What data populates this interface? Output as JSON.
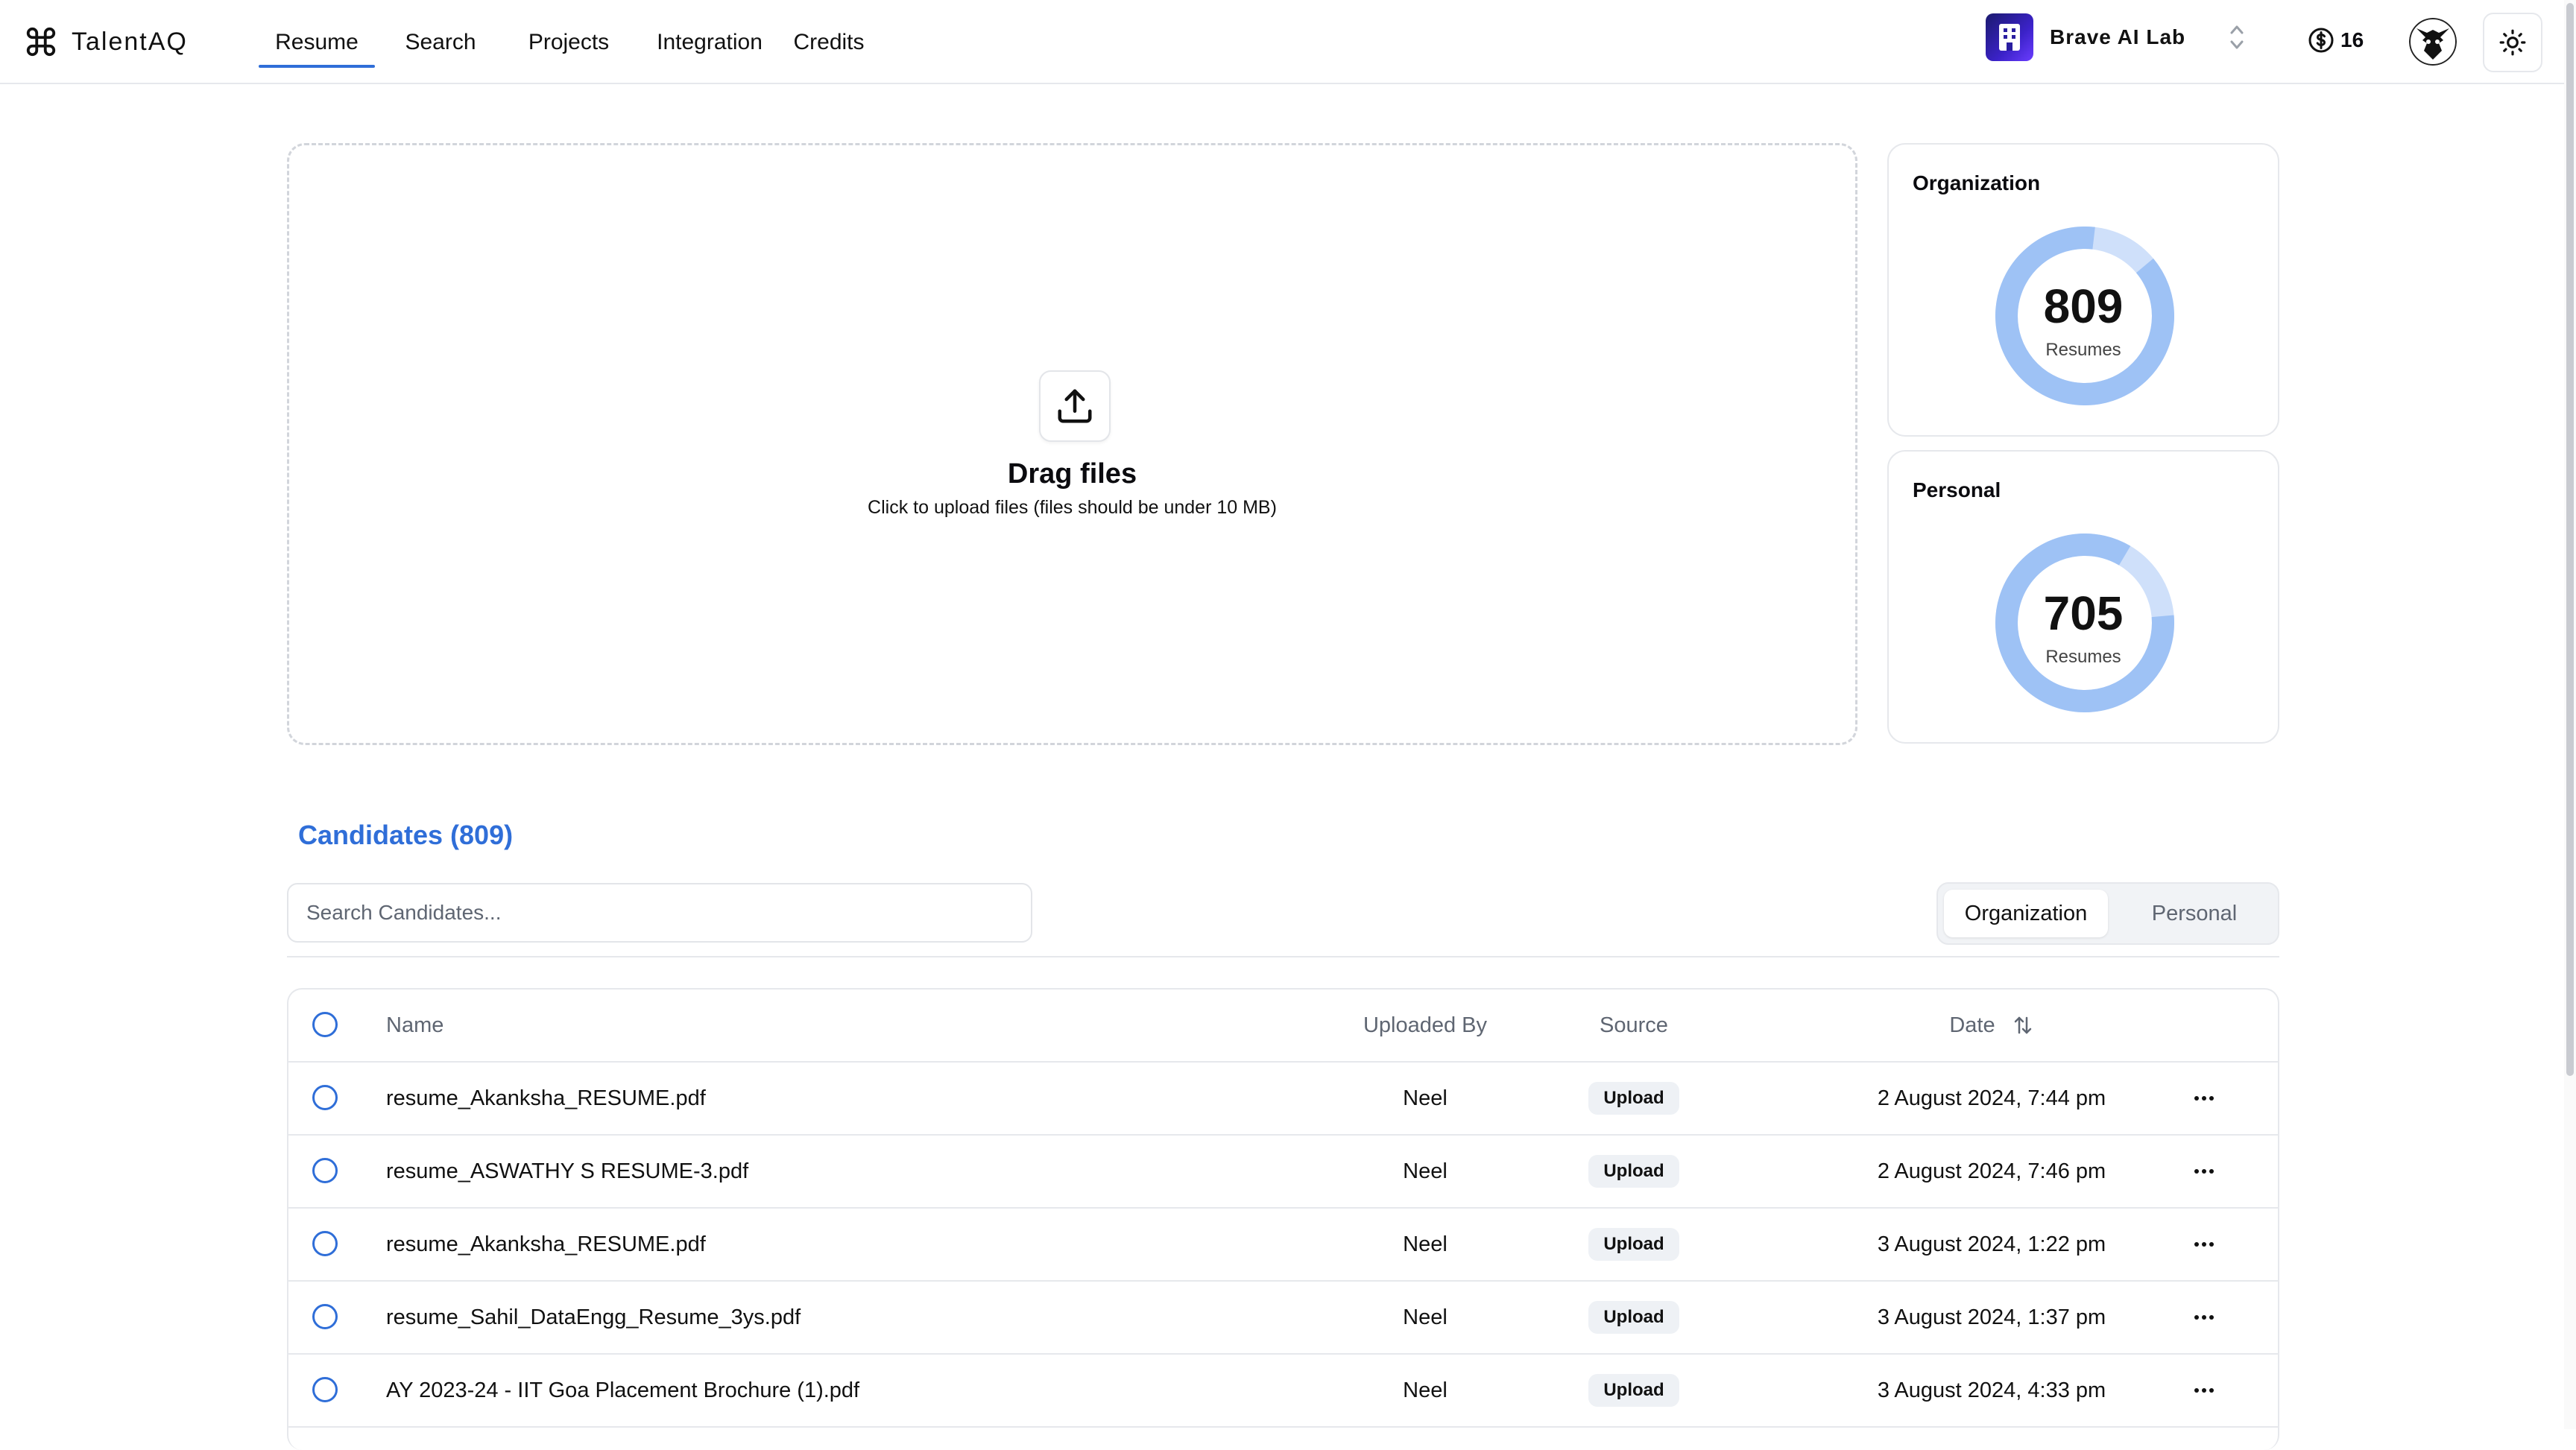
{
  "brand": {
    "name": "TalentAQ"
  },
  "nav": [
    {
      "label": "Resume",
      "active": true
    },
    {
      "label": "Search",
      "active": false
    },
    {
      "label": "Projects",
      "active": false
    },
    {
      "label": "Integration",
      "active": false
    },
    {
      "label": "Credits",
      "active": false
    }
  ],
  "org": {
    "name": "Brave AI Lab"
  },
  "credits": {
    "value": "16"
  },
  "upload": {
    "title": "Drag files",
    "subtitle": "Click to upload files (files should be under 10 MB)"
  },
  "stats": {
    "organization": {
      "title": "Organization",
      "count": "809",
      "label": "Resumes"
    },
    "personal": {
      "title": "Personal",
      "count": "705",
      "label": "Resumes"
    }
  },
  "candidates": {
    "title": "Candidates (809)",
    "search_placeholder": "Search Candidates...",
    "segments": {
      "active": "Organization",
      "inactive": "Personal"
    },
    "columns": {
      "name": "Name",
      "uploaded_by": "Uploaded By",
      "source": "Source",
      "date": "Date"
    },
    "rows": [
      {
        "name": "resume_Akanksha_RESUME.pdf",
        "uploaded_by": "Neel",
        "source": "Upload",
        "date": "2 August 2024, 7:44 pm"
      },
      {
        "name": "resume_ASWATHY S RESUME-3.pdf",
        "uploaded_by": "Neel",
        "source": "Upload",
        "date": "2 August 2024, 7:46 pm"
      },
      {
        "name": "resume_Akanksha_RESUME.pdf",
        "uploaded_by": "Neel",
        "source": "Upload",
        "date": "3 August 2024, 1:22 pm"
      },
      {
        "name": "resume_Sahil_DataEngg_Resume_3ys.pdf",
        "uploaded_by": "Neel",
        "source": "Upload",
        "date": "3 August 2024, 1:37 pm"
      },
      {
        "name": "AY 2023-24 - IIT Goa Placement Brochure (1).pdf",
        "uploaded_by": "Neel",
        "source": "Upload",
        "date": "3 August 2024, 4:33 pm"
      }
    ]
  },
  "colors": {
    "accent": "#2f6ed8",
    "donut": "#9ec2f5",
    "donut_light": "#cfe0fa"
  }
}
